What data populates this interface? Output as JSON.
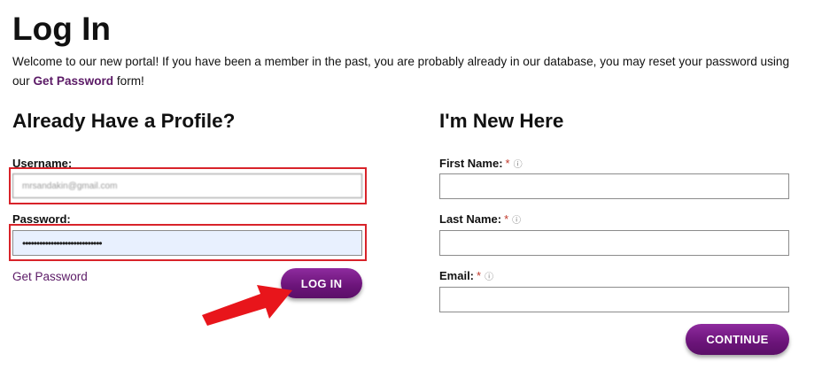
{
  "page": {
    "title": "Log In",
    "intro_before": "Welcome to our new portal! If you have been a member in the past, you are probably already in our database, you may reset your password using our ",
    "intro_link": "Get Password",
    "intro_after": " form!"
  },
  "login": {
    "heading": "Already Have a Profile?",
    "username_label": "Username:",
    "username_value": "mrsandakin@gmail.com",
    "password_label": "Password:",
    "password_value": "••••••••••••••••••••••••••••",
    "get_password_link": "Get Password",
    "login_button": "LOG IN"
  },
  "register": {
    "heading": "I'm New Here",
    "first_name_label": "First Name:",
    "last_name_label": "Last Name:",
    "email_label": "Email:",
    "required_mark": "*",
    "help_icon": "ⓘ",
    "continue_button": "CONTINUE"
  },
  "colors": {
    "brand_purple": "#6b1479",
    "link_purple": "#5b1a66",
    "highlight_red": "#d8232a",
    "arrow_red": "#e8151b"
  }
}
